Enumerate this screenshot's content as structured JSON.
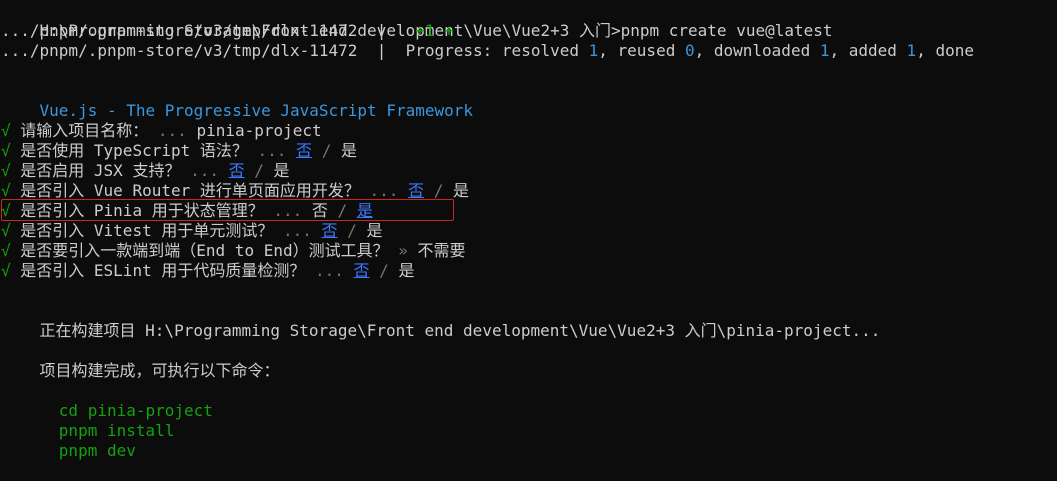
{
  "lines": {
    "cmd": "H:\\Programming Storage\\Front end development\\Vue\\Vue2+3 入门>pnpm create vue@latest",
    "tmp1_path": ".../pnpm/.pnpm-store/v3/tmp/dlx-11472",
    "tmp1_sep": "  |",
    "tmp1_plus": "   +1 +",
    "tmp2_path": ".../pnpm/.pnpm-store/v3/tmp/dlx-11472",
    "tmp2_sep": "  |",
    "tmp2_progress_label": "  Progress: resolved ",
    "tmp2_resolved": "1",
    "tmp2_reused_label": ", reused ",
    "tmp2_reused": "0",
    "tmp2_downloaded_label": ", downloaded ",
    "tmp2_downloaded": "1",
    "tmp2_added_label": ", added ",
    "tmp2_added": "1",
    "tmp2_done": ", done",
    "vue_title": "Vue.js - The Progressive JavaScript Framework",
    "building": "正在构建项目 H:\\Programming Storage\\Front end development\\Vue\\Vue2+3 入门\\pinia-project...",
    "complete": "项目构建完成，可执行以下命令：",
    "cmd1": "  cd pinia-project",
    "cmd2": "  pnpm install",
    "cmd3": "  pnpm dev"
  },
  "prompts": {
    "check": "√",
    "sep": " / ",
    "ellipsis": " ... ",
    "q1_text": " 请输入项目名称：",
    "q1_answer": "pinia-project",
    "q2_text": " 是否使用 TypeScript 语法？",
    "q2_no": "否",
    "q2_yes": "是",
    "q3_text": " 是否启用 JSX 支持？",
    "q3_no": "否",
    "q3_yes": "是",
    "q4_text": " 是否引入 Vue Router 进行单页面应用开发？",
    "q4_no": "否",
    "q4_yes": "是",
    "q5_text": " 是否引入 Pinia 用于状态管理？",
    "q5_no": "否",
    "q5_yes": "是",
    "q6_text": " 是否引入 Vitest 用于单元测试？",
    "q6_no": "否",
    "q6_yes": "是",
    "q7_text": " 是否要引入一款端到端（End to End）测试工具？",
    "q7_arrow": " » ",
    "q7_answer": "不需要",
    "q8_text": " 是否引入 ESLint 用于代码质量检测？",
    "q8_no": "否",
    "q8_yes": "是"
  }
}
